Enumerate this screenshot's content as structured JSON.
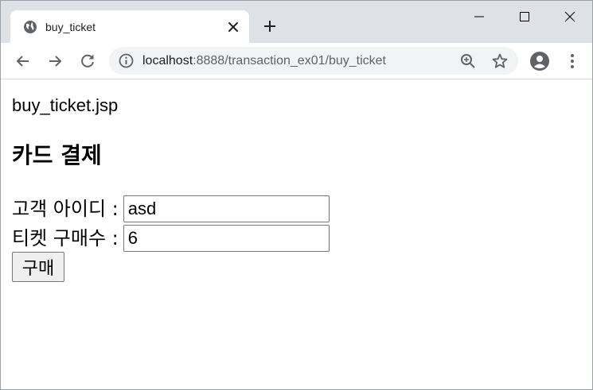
{
  "browser": {
    "tab": {
      "title": "buy_ticket"
    },
    "address": {
      "host": "localhost",
      "rest": ":8888/transaction_ex01/buy_ticket"
    }
  },
  "page": {
    "filename": "buy_ticket.jsp",
    "heading": "카드 결제",
    "form": {
      "customer_id_label": "고객 아이디 :",
      "customer_id_value": "asd",
      "ticket_count_label": "티켓 구매수 :",
      "ticket_count_value": "6",
      "submit_label": "구매"
    }
  },
  "colors": {
    "tabstrip": "#dee1e6",
    "omnibox": "#f1f3f4",
    "icon": "#5f6368"
  }
}
